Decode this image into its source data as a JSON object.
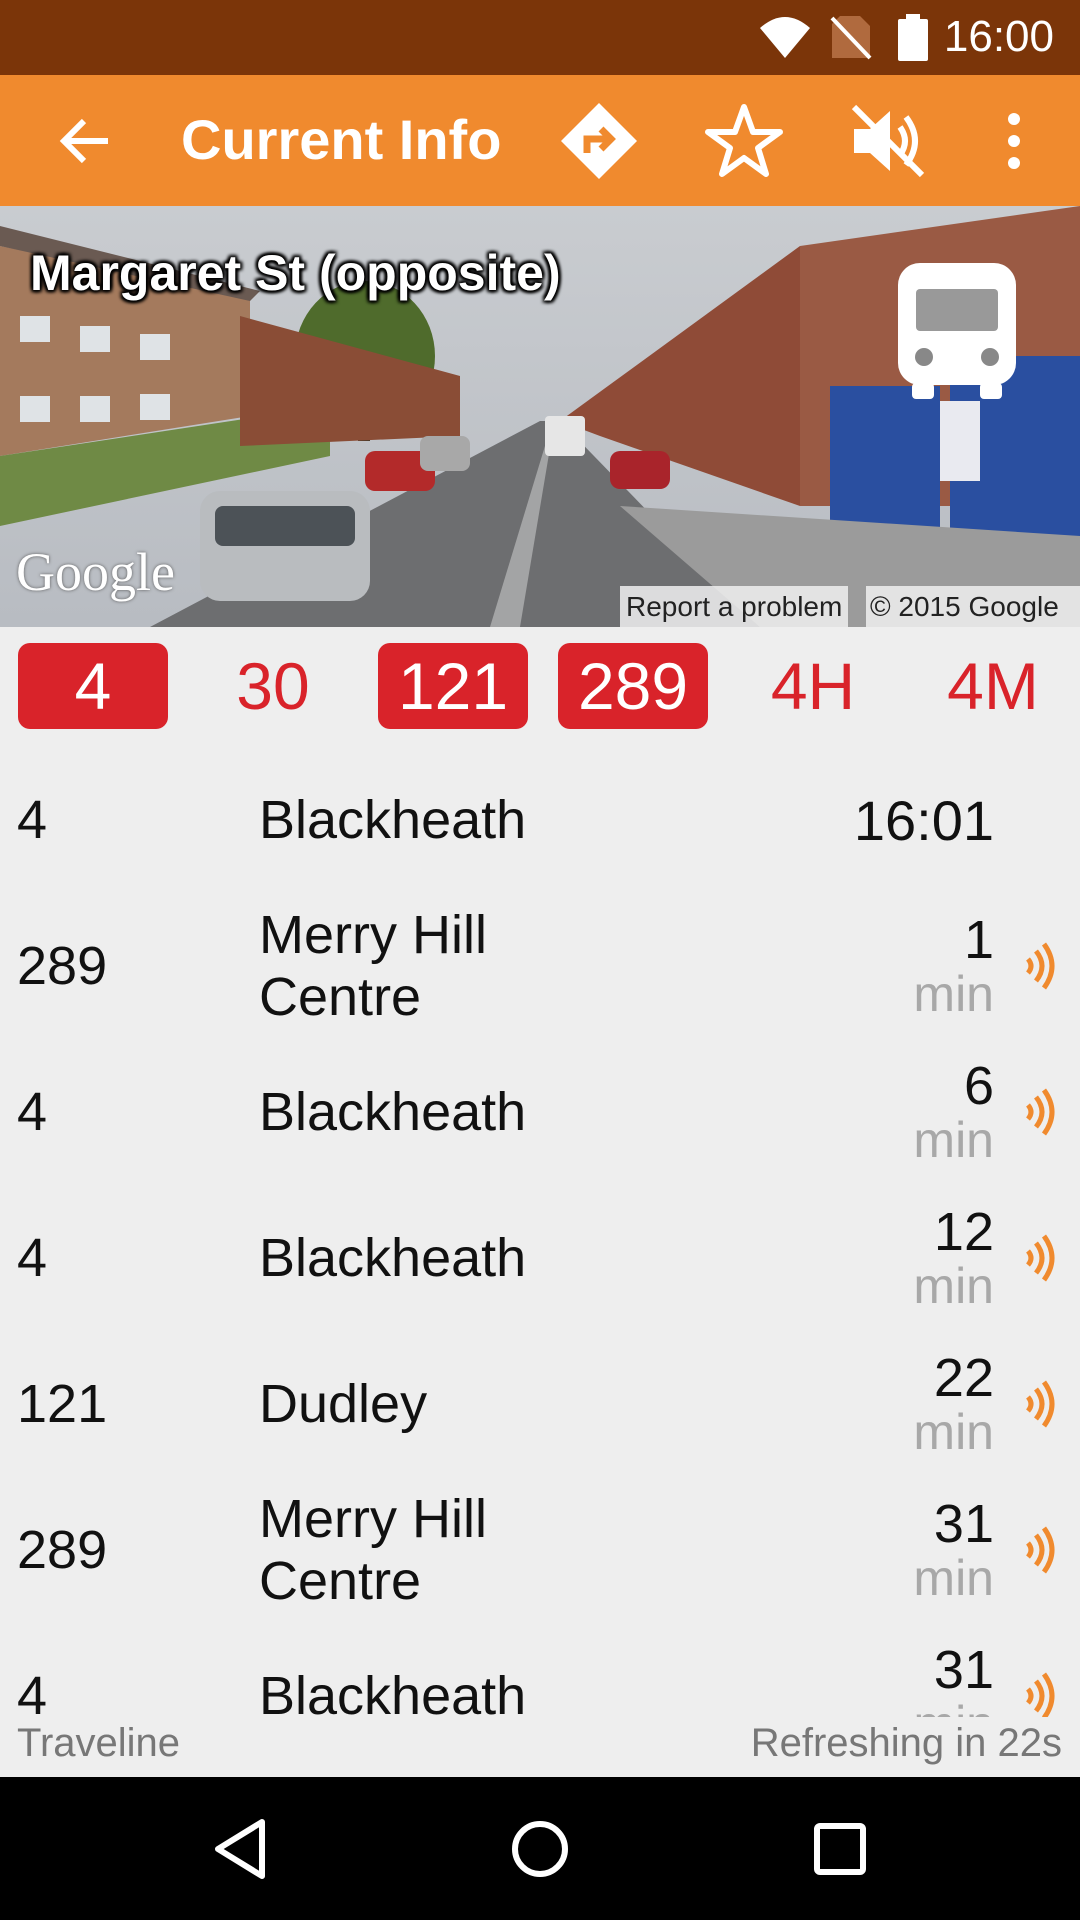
{
  "status_bar": {
    "time": "16:00",
    "icons": [
      "wifi-icon",
      "no-sim-icon",
      "battery-icon"
    ]
  },
  "app_bar": {
    "title": "Current Info",
    "icons": [
      "back-arrow-icon",
      "directions-icon",
      "star-outline-icon",
      "volume-off-icon",
      "more-vert-icon"
    ]
  },
  "street_view": {
    "stop_name": "Margaret St (opposite)",
    "logo": "Google",
    "report_link": "Report a problem",
    "copyright": "© 2015 Google"
  },
  "routes": [
    {
      "label": "4",
      "selected": true
    },
    {
      "label": "30",
      "selected": false
    },
    {
      "label": "121",
      "selected": true
    },
    {
      "label": "289",
      "selected": true
    },
    {
      "label": "4H",
      "selected": false
    },
    {
      "label": "4M",
      "selected": false
    }
  ],
  "departures": [
    {
      "route": "4",
      "destination": "Blackheath",
      "time": "16:01",
      "live": false
    },
    {
      "route": "289",
      "destination": "Merry Hill Centre",
      "minutes": "1",
      "unit": "min",
      "live": true
    },
    {
      "route": "4",
      "destination": "Blackheath",
      "minutes": "6",
      "unit": "min",
      "live": true
    },
    {
      "route": "4",
      "destination": "Blackheath",
      "minutes": "12",
      "unit": "min",
      "live": true
    },
    {
      "route": "121",
      "destination": "Dudley",
      "minutes": "22",
      "unit": "min",
      "live": true
    },
    {
      "route": "289",
      "destination": "Merry Hill Centre",
      "minutes": "31",
      "unit": "min",
      "live": true
    },
    {
      "route": "4",
      "destination": "Blackheath",
      "minutes": "31",
      "unit": "min",
      "live": true
    }
  ],
  "footer": {
    "source": "Traveline",
    "refresh": "Refreshing in 22s"
  },
  "colors": {
    "status_bar": "#7b3509",
    "app_bar": "#f08a2e",
    "route_red": "#d9232a",
    "live_orange": "#f08a2e"
  }
}
